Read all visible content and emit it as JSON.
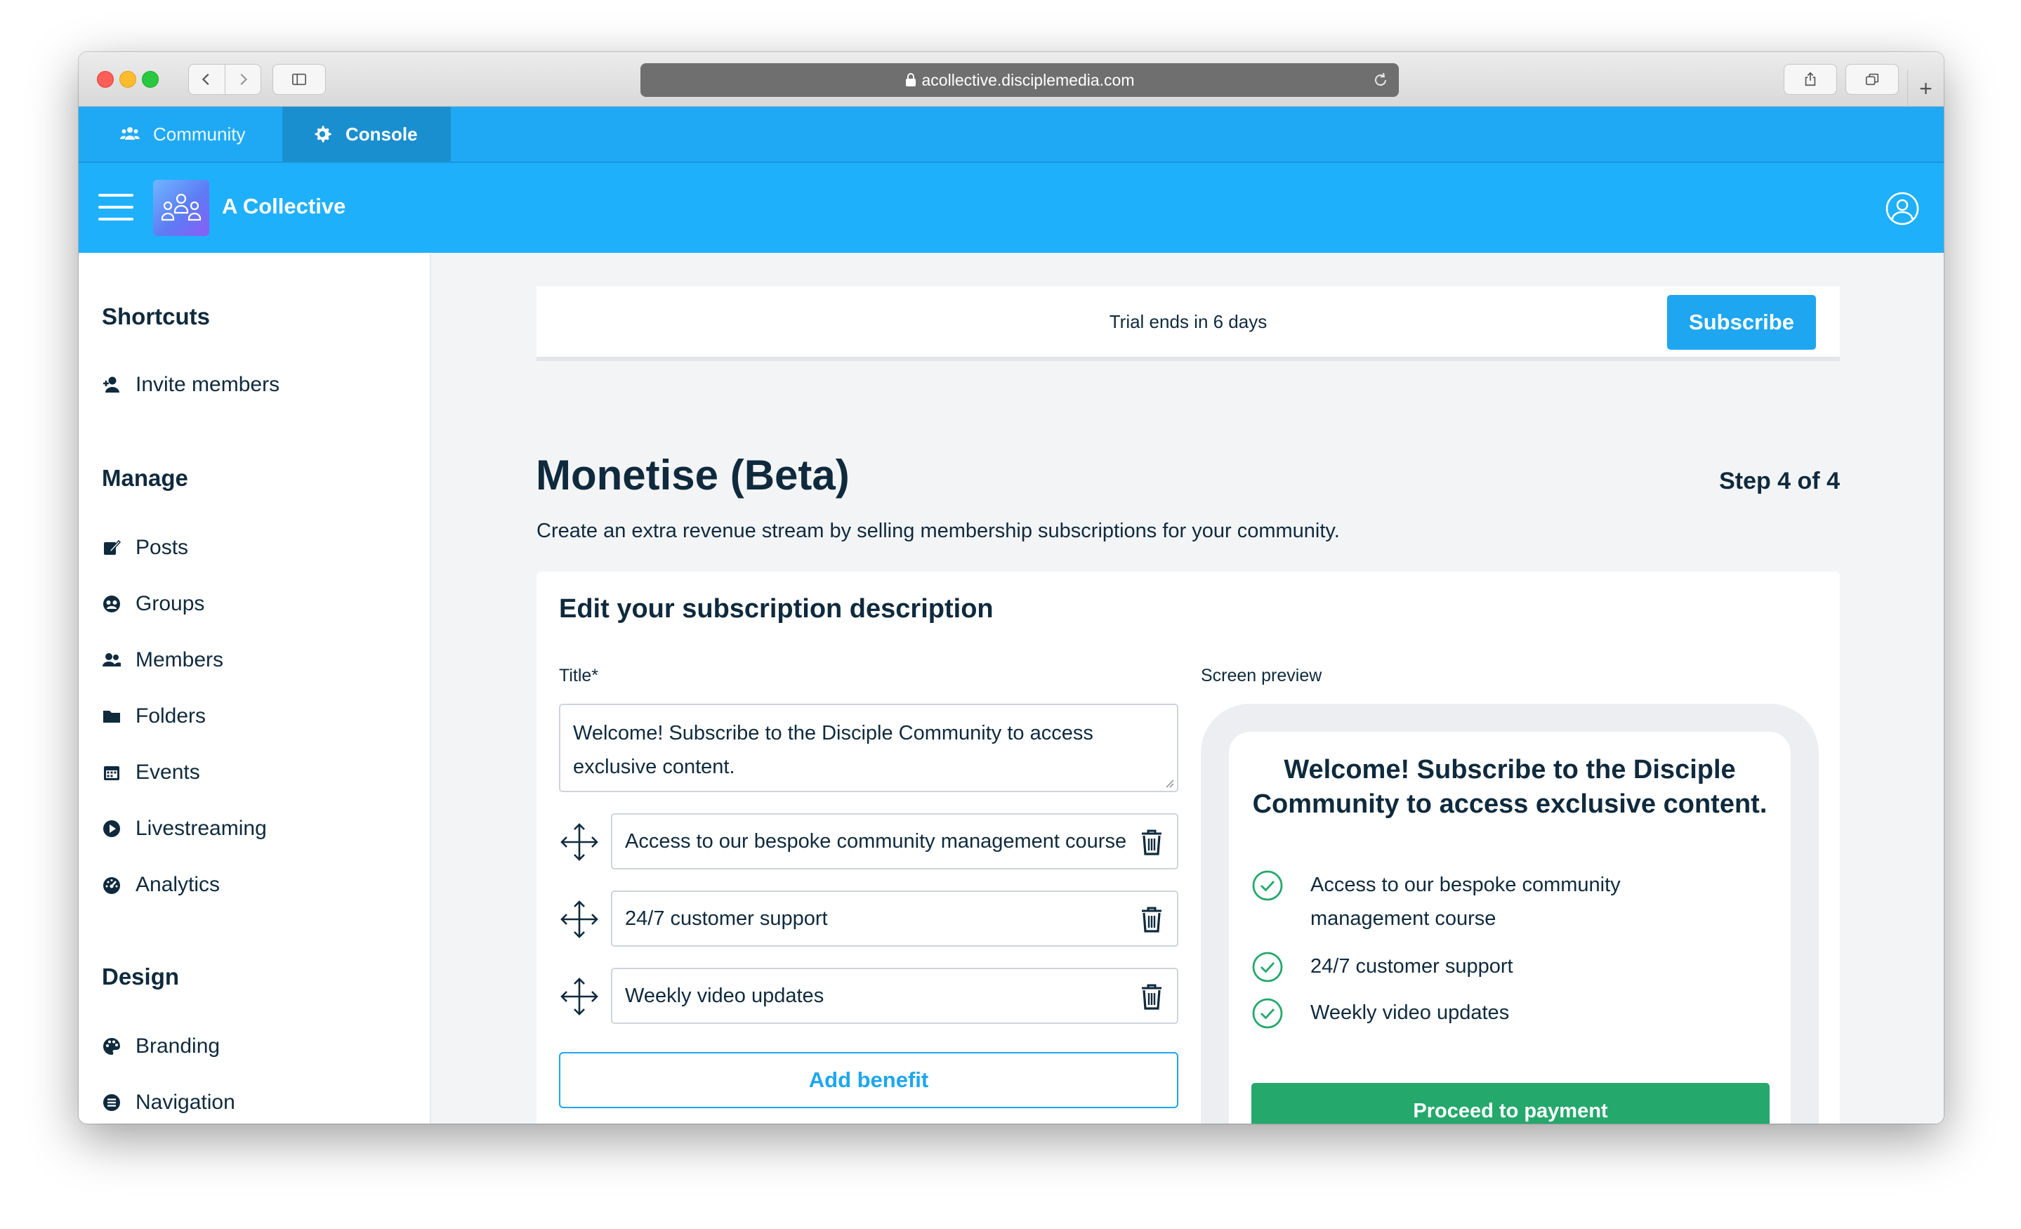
{
  "browser": {
    "url": "acollective.disciplemedia.com"
  },
  "topnav": {
    "tabs": [
      {
        "label": "Community",
        "icon": "people-icon",
        "active": false
      },
      {
        "label": "Console",
        "icon": "gear-icon",
        "active": true
      }
    ]
  },
  "header": {
    "app_name": "A Collective"
  },
  "sidebar": {
    "sections": [
      {
        "title": "Shortcuts",
        "items": [
          {
            "label": "Invite members",
            "icon": "add-user-icon"
          }
        ]
      },
      {
        "title": "Manage",
        "items": [
          {
            "label": "Posts",
            "icon": "edit-icon"
          },
          {
            "label": "Groups",
            "icon": "group-icon"
          },
          {
            "label": "Members",
            "icon": "members-icon"
          },
          {
            "label": "Folders",
            "icon": "folder-icon"
          },
          {
            "label": "Events",
            "icon": "calendar-icon"
          },
          {
            "label": "Livestreaming",
            "icon": "play-icon"
          },
          {
            "label": "Analytics",
            "icon": "gauge-icon"
          }
        ]
      },
      {
        "title": "Design",
        "items": [
          {
            "label": "Branding",
            "icon": "palette-icon"
          },
          {
            "label": "Navigation",
            "icon": "menu-list-icon"
          }
        ]
      }
    ]
  },
  "trial": {
    "text": "Trial ends in 6 days",
    "subscribe_label": "Subscribe"
  },
  "page": {
    "title": "Monetise (Beta)",
    "step": "Step 4 of 4",
    "description": "Create an extra revenue stream by selling membership subscriptions for your community."
  },
  "form": {
    "card_title": "Edit your subscription description",
    "title_label": "Title*",
    "title_value": "Welcome! Subscribe to the Disciple Community to access exclusive content.",
    "benefits": [
      "Access to our bespoke community management course",
      "24/7 customer support",
      "Weekly video updates"
    ],
    "add_benefit_label": "Add benefit"
  },
  "preview": {
    "label": "Screen preview",
    "title": "Welcome! Subscribe to the Disciple Community to access exclusive content.",
    "benefits": [
      "Access to our bespoke community management course",
      "24/7 customer support",
      "Weekly video updates"
    ],
    "button_label": "Proceed to payment"
  },
  "colors": {
    "brand_blue": "#1fb0fb",
    "accent_blue": "#1ea6f0",
    "success_green": "#24a86c"
  }
}
